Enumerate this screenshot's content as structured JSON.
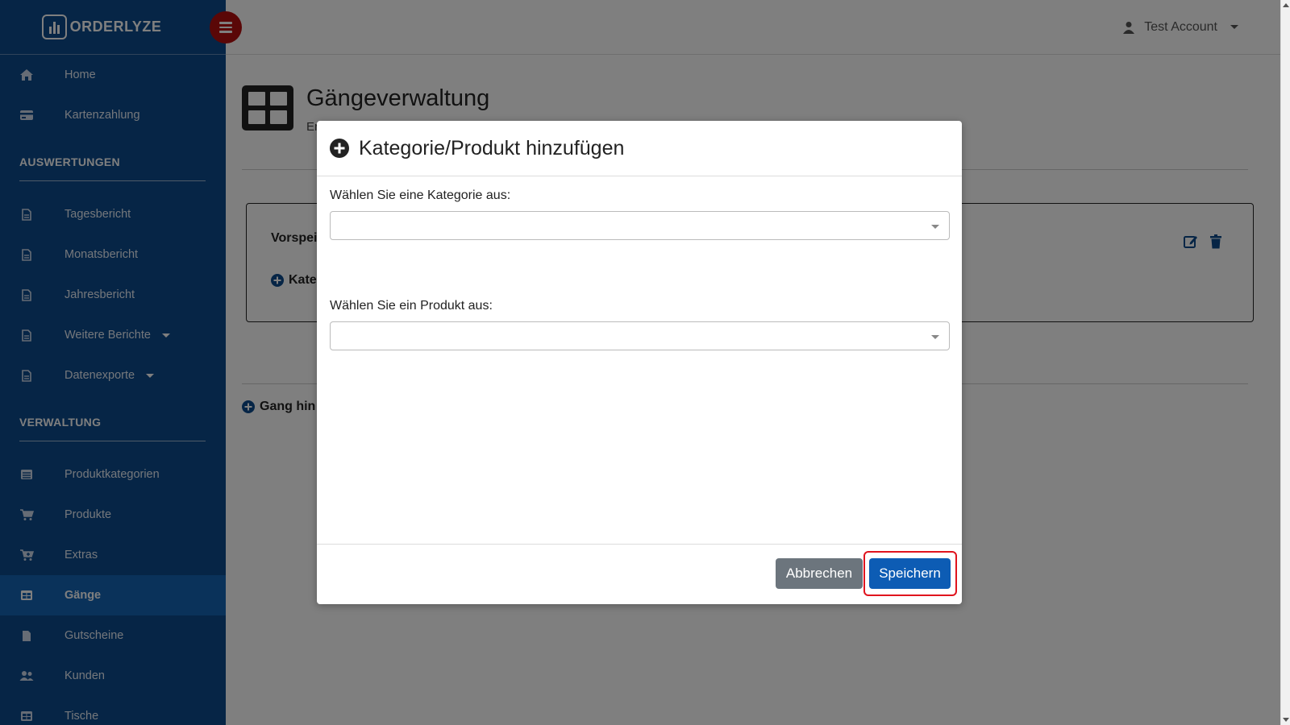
{
  "brand": {
    "name": "ORDERLYZE"
  },
  "sidebar": {
    "top_items": [
      {
        "label": "Home",
        "icon": "home-icon"
      },
      {
        "label": "Kartenzahlung",
        "icon": "credit-card-icon"
      }
    ],
    "sections": [
      {
        "title": "AUSWERTUNGEN",
        "items": [
          {
            "label": "Tagesbericht",
            "icon": "file-icon"
          },
          {
            "label": "Monatsbericht",
            "icon": "file-icon"
          },
          {
            "label": "Jahresbericht",
            "icon": "file-icon"
          },
          {
            "label": "Weitere Berichte",
            "icon": "file-icon",
            "dropdown": true
          },
          {
            "label": "Datenexporte",
            "icon": "file-icon",
            "dropdown": true
          }
        ]
      },
      {
        "title": "VERWALTUNG",
        "items": [
          {
            "label": "Produktkategorien",
            "icon": "list-icon"
          },
          {
            "label": "Produkte",
            "icon": "cart-icon"
          },
          {
            "label": "Extras",
            "icon": "cart-plus-icon"
          },
          {
            "label": "Gänge",
            "icon": "table-icon",
            "active": true
          },
          {
            "label": "Gutscheine",
            "icon": "file-icon"
          },
          {
            "label": "Kunden",
            "icon": "users-icon"
          },
          {
            "label": "Tische",
            "icon": "table-icon"
          }
        ]
      }
    ]
  },
  "header": {
    "account_label": "Test Account"
  },
  "page": {
    "title": "Gängeverwaltung",
    "subtitle_partial": "Er",
    "course_name_partial": "Vorspei",
    "add_category_partial": "Kate",
    "add_course_partial": "Gang hin"
  },
  "modal": {
    "title": "Kategorie/Produkt hinzufügen",
    "category_label": "Wählen Sie eine Kategorie aus:",
    "category_value": "",
    "product_label": "Wählen Sie ein Produkt aus:",
    "product_value": "",
    "cancel_label": "Abbrechen",
    "save_label": "Speichern"
  },
  "colors": {
    "sidebar_bg": "#0c4a8c",
    "active_item": "#1565b4",
    "toggle_button": "#b50f0f",
    "save_button": "#0d5cb4",
    "cancel_button": "#6c757d",
    "highlight_border": "#e0141e"
  }
}
